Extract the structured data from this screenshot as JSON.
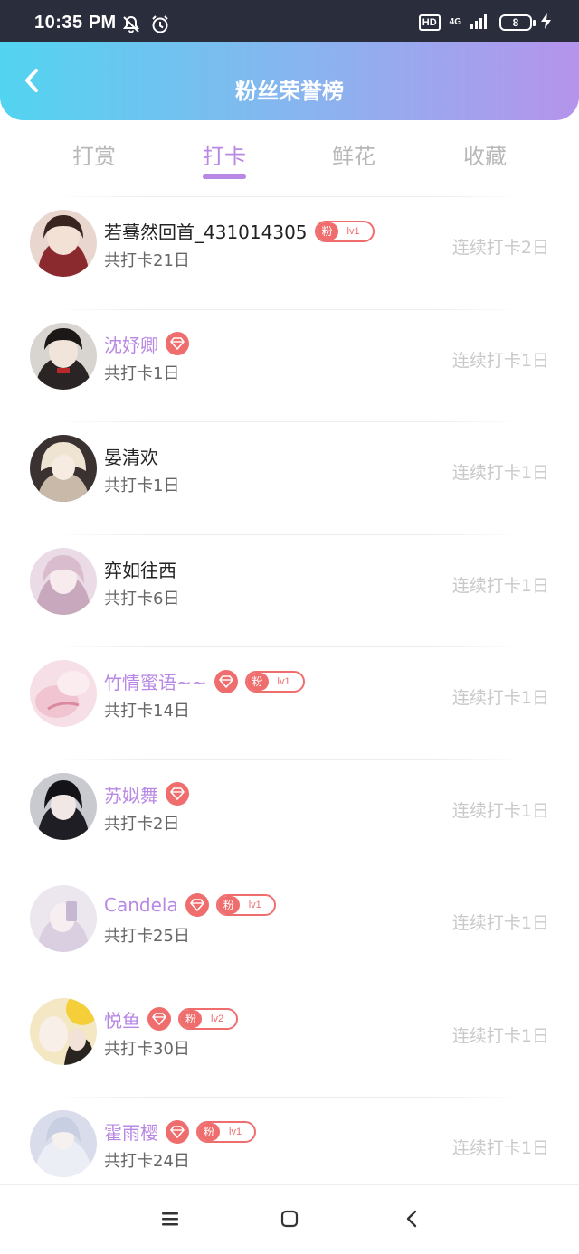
{
  "status_bar": {
    "time": "10:35 PM",
    "hd": "HD",
    "network": "4G",
    "battery": "8",
    "icons": [
      "bell-muted-icon",
      "alarm-icon",
      "signal-icon",
      "charging-icon"
    ]
  },
  "header": {
    "title": "粉丝荣誉榜",
    "back_icon": "chevron-left-icon"
  },
  "tabs": [
    {
      "label": "打赏",
      "active": false
    },
    {
      "label": "打卡",
      "active": true
    },
    {
      "label": "鲜花",
      "active": false
    },
    {
      "label": "收藏",
      "active": false
    }
  ],
  "fan_badge_label": "粉",
  "rows": [
    {
      "name": "若蓦然回首_431014305",
      "vip": false,
      "gem": false,
      "fan_level": "lv1",
      "total": "共打卡21日",
      "streak": "连续打卡2日"
    },
    {
      "name": "沈妤卿",
      "vip": true,
      "gem": true,
      "fan_level": null,
      "total": "共打卡1日",
      "streak": "连续打卡1日"
    },
    {
      "name": "晏清欢",
      "vip": false,
      "gem": false,
      "fan_level": null,
      "total": "共打卡1日",
      "streak": "连续打卡1日"
    },
    {
      "name": "弈如往西",
      "vip": false,
      "gem": false,
      "fan_level": null,
      "total": "共打卡6日",
      "streak": "连续打卡1日"
    },
    {
      "name": "竹情蜜语~~",
      "vip": true,
      "gem": true,
      "fan_level": "lv1",
      "total": "共打卡14日",
      "streak": "连续打卡1日"
    },
    {
      "name": "苏姒舞",
      "vip": true,
      "gem": true,
      "fan_level": null,
      "total": "共打卡2日",
      "streak": "连续打卡1日"
    },
    {
      "name": "Candela",
      "vip": true,
      "gem": true,
      "fan_level": "lv1",
      "total": "共打卡25日",
      "streak": "连续打卡1日"
    },
    {
      "name": "悦鱼",
      "vip": true,
      "gem": true,
      "fan_level": "lv2",
      "total": "共打卡30日",
      "streak": "连续打卡1日"
    },
    {
      "name": "霍雨樱",
      "vip": true,
      "gem": true,
      "fan_level": "lv1",
      "total": "共打卡24日",
      "streak": "连续打卡1日"
    }
  ],
  "colors": {
    "accent": "#b888e4",
    "badge": "#ef6d6d",
    "header_gradient": [
      "#52d4f0",
      "#86b6ef",
      "#b594ec"
    ]
  },
  "bottom_nav": [
    "menu-icon",
    "home-square-icon",
    "back-chevron-icon"
  ]
}
